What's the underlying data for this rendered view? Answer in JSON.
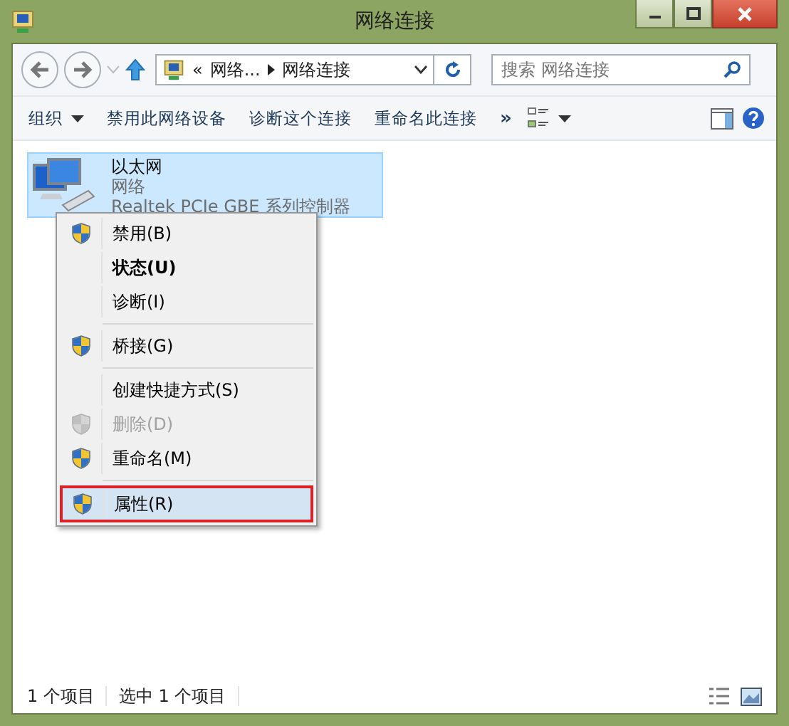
{
  "window": {
    "title": "网络连接"
  },
  "address": {
    "chevron": "«",
    "path": [
      "网络...",
      "网络连接"
    ]
  },
  "search": {
    "placeholder": "搜索 网络连接"
  },
  "toolbar": {
    "items": [
      {
        "label": "组织",
        "dropdown": true
      },
      {
        "label": "禁用此网络设备",
        "dropdown": false
      },
      {
        "label": "诊断这个连接",
        "dropdown": false
      },
      {
        "label": "重命名此连接",
        "dropdown": false
      }
    ],
    "more": "»"
  },
  "connections": [
    {
      "name": "以太网",
      "network": "网络",
      "device": "Realtek PCIe GBE 系列控制器",
      "selected": true
    }
  ],
  "context_menu": [
    {
      "kind": "item",
      "label": "禁用(B)",
      "shield": true,
      "bold": false,
      "disabled": false,
      "selected": false
    },
    {
      "kind": "item",
      "label": "状态(U)",
      "shield": false,
      "bold": true,
      "disabled": false,
      "selected": false
    },
    {
      "kind": "item",
      "label": "诊断(I)",
      "shield": false,
      "bold": false,
      "disabled": false,
      "selected": false
    },
    {
      "kind": "separator"
    },
    {
      "kind": "item",
      "label": "桥接(G)",
      "shield": true,
      "bold": false,
      "disabled": false,
      "selected": false
    },
    {
      "kind": "separator"
    },
    {
      "kind": "item",
      "label": "创建快捷方式(S)",
      "shield": false,
      "bold": false,
      "disabled": false,
      "selected": false
    },
    {
      "kind": "item",
      "label": "删除(D)",
      "shield": true,
      "bold": false,
      "disabled": true,
      "selected": false
    },
    {
      "kind": "item",
      "label": "重命名(M)",
      "shield": true,
      "bold": false,
      "disabled": false,
      "selected": false
    },
    {
      "kind": "separator"
    },
    {
      "kind": "item",
      "label": "属性(R)",
      "shield": true,
      "bold": false,
      "disabled": false,
      "selected": true
    }
  ],
  "status_bar": [
    "1 个项目",
    "选中 1 个项目"
  ]
}
